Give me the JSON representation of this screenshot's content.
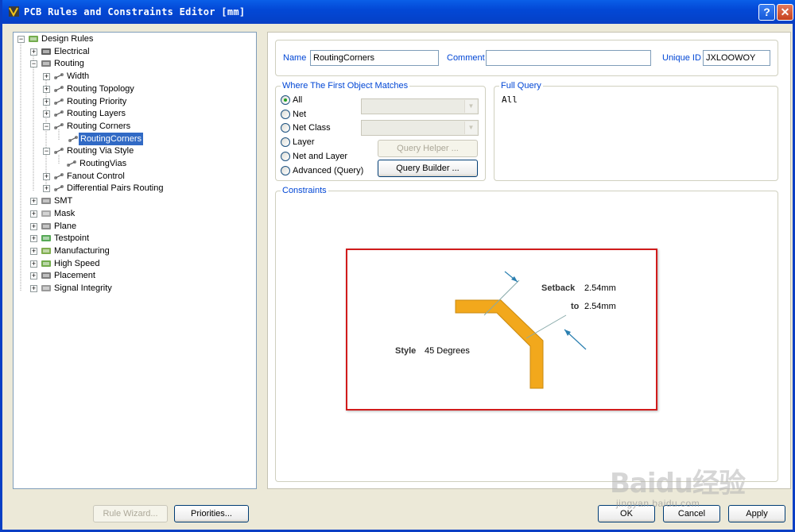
{
  "window": {
    "title": "PCB Rules and Constraints Editor [mm]",
    "help_label": "?",
    "close_label": "✕"
  },
  "tree": {
    "items": [
      {
        "label": "Design Rules",
        "icon": "design-rules-icon"
      },
      {
        "label": "Electrical",
        "icon": "electrical-icon"
      },
      {
        "label": "Routing",
        "icon": "routing-icon"
      },
      {
        "label": "Width",
        "icon": "rule-icon"
      },
      {
        "label": "Routing Topology",
        "icon": "rule-icon"
      },
      {
        "label": "Routing Priority",
        "icon": "rule-icon"
      },
      {
        "label": "Routing Layers",
        "icon": "rule-icon"
      },
      {
        "label": "Routing Corners",
        "icon": "rule-icon"
      },
      {
        "label": "RoutingCorners",
        "icon": "rule-icon"
      },
      {
        "label": "Routing Via Style",
        "icon": "rule-icon"
      },
      {
        "label": "RoutingVias",
        "icon": "rule-icon"
      },
      {
        "label": "Fanout Control",
        "icon": "rule-icon"
      },
      {
        "label": "Differential Pairs Routing",
        "icon": "rule-icon"
      },
      {
        "label": "SMT",
        "icon": "smt-icon"
      },
      {
        "label": "Mask",
        "icon": "mask-icon"
      },
      {
        "label": "Plane",
        "icon": "plane-icon"
      },
      {
        "label": "Testpoint",
        "icon": "testpoint-icon"
      },
      {
        "label": "Manufacturing",
        "icon": "manufacturing-icon"
      },
      {
        "label": "High Speed",
        "icon": "high-speed-icon"
      },
      {
        "label": "Placement",
        "icon": "placement-icon"
      },
      {
        "label": "Signal Integrity",
        "icon": "signal-integrity-icon"
      }
    ]
  },
  "rule": {
    "name_label": "Name",
    "name_value": "RoutingCorners",
    "comment_label": "Comment",
    "comment_value": "",
    "uid_label": "Unique ID",
    "uid_value": "JXLOOWOY"
  },
  "match": {
    "title": "Where The First Object Matches",
    "options": [
      "All",
      "Net",
      "Net Class",
      "Layer",
      "Net and Layer",
      "Advanced (Query)"
    ],
    "selected": "All",
    "query_helper_label": "Query Helper ...",
    "query_builder_label": "Query Builder ..."
  },
  "full_query": {
    "title": "Full Query",
    "text": "All"
  },
  "constraints": {
    "title": "Constraints",
    "style_label": "Style",
    "style_value": "45 Degrees",
    "setback_label": "Setback",
    "setback_value": "2.54mm",
    "to_label": "to",
    "to_value": "2.54mm",
    "track_color": "#f2a81c"
  },
  "buttons": {
    "rule_wizard": "Rule Wizard...",
    "priorities": "Priorities...",
    "ok": "OK",
    "cancel": "Cancel",
    "apply": "Apply"
  },
  "watermark": {
    "main": "Baidu经验",
    "sub": "jingyan.baidu.com"
  }
}
